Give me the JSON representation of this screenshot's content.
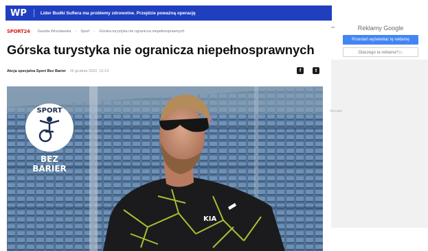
{
  "topbar": {
    "logo": "WP",
    "headline": "Lider Budki Suflera ma problemy zdrowotne. Przejdzie poważną operację"
  },
  "breadcrumb": {
    "brand": "SPORT24",
    "items": [
      "Gazeta Wrocławska",
      "Sport",
      "Górska turystyka nie ogranicza niepełnosprawnych"
    ]
  },
  "article": {
    "title": "Górska turystyka nie ogranicza niepełnosprawnych",
    "author": "Akcja specjalna Sport Bez Barier",
    "date": "16 grudnia 2022, 12:13"
  },
  "share": {
    "facebook_icon": "f",
    "twitter_icon": "t"
  },
  "hero": {
    "logo_top": "SPORT",
    "logo_bottom_1": "BEZ",
    "logo_bottom_2": "BARIER",
    "shirt_text": "KIA"
  },
  "sidebar": {
    "ad_tag": "Ad",
    "ads_title": "Reklamy Google",
    "feedback_button": "Przestań wyświetlać tę reklamę",
    "why_button": "Dlaczego ta reklama? ▷",
    "reklama_label": "REKLAMA"
  },
  "colors": {
    "topbar": "#1f3fbf",
    "brand_red": "#d9231d",
    "google_blue": "#4285f4"
  }
}
